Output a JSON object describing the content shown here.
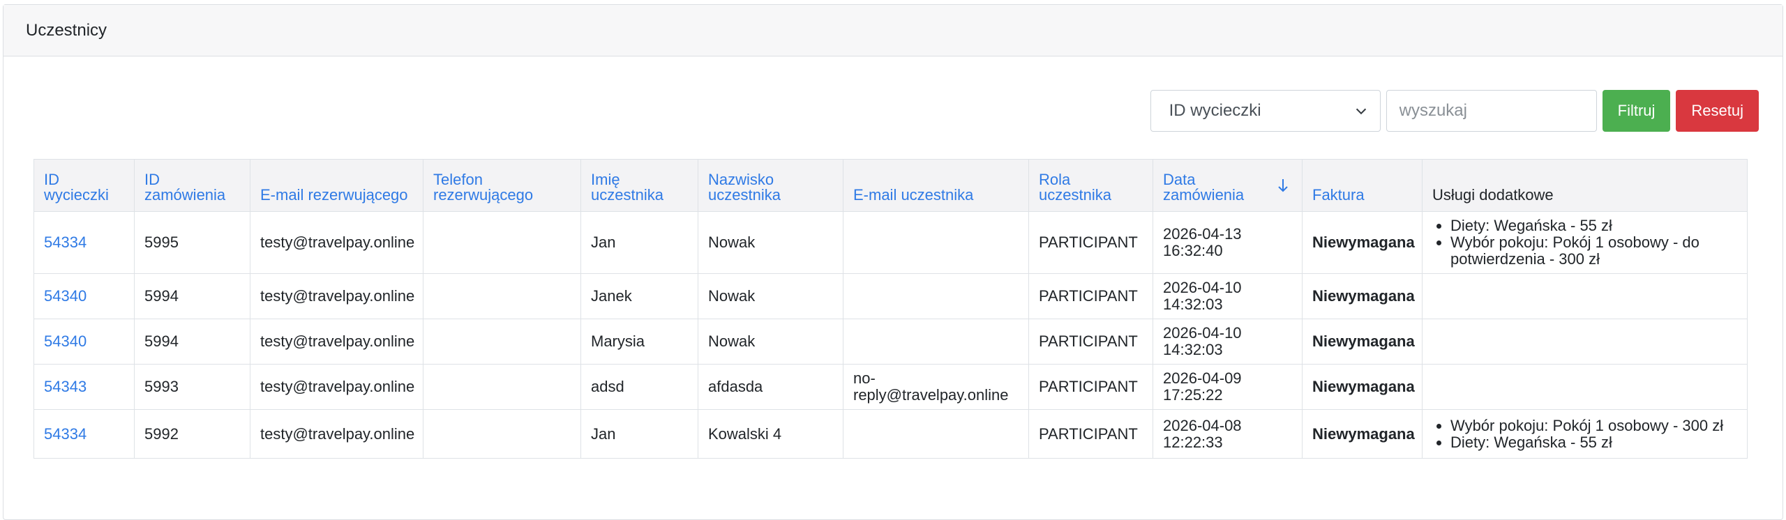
{
  "header": {
    "title": "Uczestnicy"
  },
  "filters": {
    "select_value": "ID wycieczki",
    "search_placeholder": "wyszukaj",
    "filter_label": "Filtruj",
    "reset_label": "Resetuj"
  },
  "table": {
    "columns": [
      {
        "line1": "ID",
        "line2": "wycieczki"
      },
      {
        "line1": "ID",
        "line2": "zamówienia"
      },
      {
        "line1": "",
        "line2": "E-mail rezerwującego"
      },
      {
        "line1": "Telefon",
        "line2": "rezerwującego"
      },
      {
        "line1": "Imię",
        "line2": "uczestnika"
      },
      {
        "line1": "Nazwisko",
        "line2": "uczestnika"
      },
      {
        "line1": "",
        "line2": "E-mail uczestnika"
      },
      {
        "line1": "Rola",
        "line2": "uczestnika"
      },
      {
        "line1": "Data",
        "line2": "zamówienia"
      },
      {
        "line1": "",
        "line2": "Faktura"
      },
      {
        "line1": "",
        "line2": "Usługi dodatkowe"
      }
    ],
    "rows": [
      {
        "trip_id": "54334",
        "order_id": "5995",
        "email": "testy@travelpay.online",
        "phone": "",
        "first_name": "Jan",
        "last_name": "Nowak",
        "participant_email": "",
        "role": "PARTICIPANT",
        "date": "2026-04-13",
        "time": "16:32:40",
        "invoice": "Niewymagana",
        "services": [
          "Diety: Wegańska - 55 zł",
          "Wybór pokoju: Pokój 1 osobowy - do potwierdzenia - 300 zł"
        ]
      },
      {
        "trip_id": "54340",
        "order_id": "5994",
        "email": "testy@travelpay.online",
        "phone": "",
        "first_name": "Janek",
        "last_name": "Nowak",
        "participant_email": "",
        "role": "PARTICIPANT",
        "date": "2026-04-10",
        "time": "14:32:03",
        "invoice": "Niewymagana",
        "services": []
      },
      {
        "trip_id": "54340",
        "order_id": "5994",
        "email": "testy@travelpay.online",
        "phone": "",
        "first_name": "Marysia",
        "last_name": "Nowak",
        "participant_email": "",
        "role": "PARTICIPANT",
        "date": "2026-04-10",
        "time": "14:32:03",
        "invoice": "Niewymagana",
        "services": []
      },
      {
        "trip_id": "54343",
        "order_id": "5993",
        "email": "testy@travelpay.online",
        "phone": "",
        "first_name": "adsd",
        "last_name": "afdasda",
        "participant_email": "no-reply@travelpay.online",
        "role": "PARTICIPANT",
        "date": "2026-04-09",
        "time": "17:25:22",
        "invoice": "Niewymagana",
        "services": []
      },
      {
        "trip_id": "54334",
        "order_id": "5992",
        "email": "testy@travelpay.online",
        "phone": "",
        "first_name": "Jan",
        "last_name": "Kowalski 4",
        "participant_email": "",
        "role": "PARTICIPANT",
        "date": "2026-04-08",
        "time": "12:22:33",
        "invoice": "Niewymagana",
        "services": [
          "Wybór pokoju: Pokój 1 osobowy - 300 zł",
          "Diety: Wegańska - 55 zł"
        ]
      }
    ]
  },
  "colors": {
    "link": "#2f7ae5",
    "filter_button": "#4caf50",
    "reset_button": "#d9383f"
  },
  "icons": {
    "sort": "arrow-down-icon",
    "select": "chevron-down-icon"
  }
}
